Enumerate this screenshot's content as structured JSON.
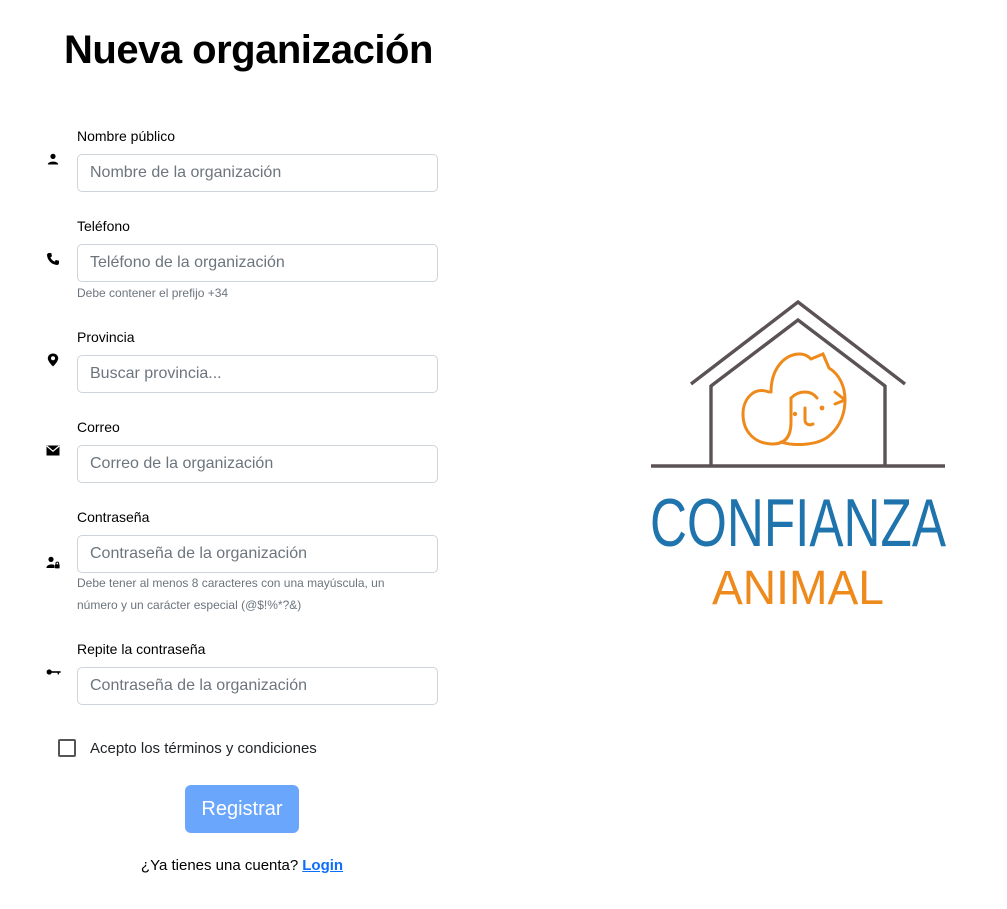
{
  "page": {
    "title": "Nueva organización"
  },
  "form": {
    "fields": [
      {
        "label": "Nombre público",
        "placeholder": "Nombre de la organización",
        "value": "",
        "icon": "user-icon"
      },
      {
        "label": "Teléfono",
        "placeholder": "Teléfono de la organización",
        "value": "",
        "help": "Debe contener el prefijo +34",
        "icon": "phone-icon"
      },
      {
        "label": "Provincia",
        "placeholder": "Buscar provincia...",
        "value": "",
        "icon": "location-pin-icon"
      },
      {
        "label": "Correo",
        "placeholder": "Correo de la organización",
        "value": "",
        "icon": "envelope-icon"
      },
      {
        "label": "Contraseña",
        "placeholder": "Contraseña de la organización",
        "value": "",
        "help": "Debe tener al menos 8 caracteres con una mayúscula, un número y un carácter especial (@$!%*?&)",
        "icon": "user-lock-icon"
      },
      {
        "label": "Repite la contraseña",
        "placeholder": "Contraseña de la organización",
        "value": "",
        "icon": "key-icon"
      }
    ],
    "terms_label": "Acepto los términos y condiciones",
    "terms_checked": false,
    "register_label": "Registrar",
    "login_prompt": "¿Ya tienes una cuenta?",
    "login_link": "Login"
  },
  "logo": {
    "line1": "CONFIANZA",
    "line2": "ANIMAL",
    "colors": {
      "house": "#5a5254",
      "pet": "#ee8a1c",
      "line1": "#1f74ad",
      "line2": "#ee8a1c"
    }
  },
  "colors": {
    "button": "#6aa6fb",
    "link": "#0d6efd",
    "border": "#ced4da",
    "help_text": "#6c757d"
  }
}
